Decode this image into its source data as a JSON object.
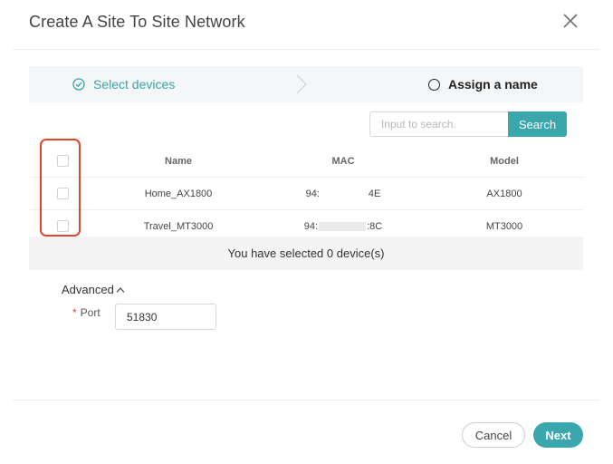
{
  "dialog": {
    "title": "Create A Site To Site Network"
  },
  "steps": {
    "step1_label": "Select devices",
    "step2_label": "Assign a name"
  },
  "search": {
    "placeholder": "Input to search.",
    "button_label": "Search"
  },
  "table": {
    "columns": [
      "Name",
      "MAC",
      "Model"
    ],
    "rows": [
      {
        "name": "Home_AX1800",
        "mac_prefix": "94:",
        "mac_suffix": "4E",
        "model": "AX1800",
        "checked": false
      },
      {
        "name": "Travel_MT3000",
        "mac_prefix": "94:",
        "mac_suffix": ":8C",
        "model": "MT3000",
        "checked": false
      }
    ]
  },
  "summary": {
    "text": "You have selected 0 device(s)"
  },
  "advanced": {
    "label": "Advanced",
    "port_label": "Port",
    "port_required": "*",
    "port_value": "51830"
  },
  "footer": {
    "cancel_label": "Cancel",
    "next_label": "Next"
  },
  "colors": {
    "accent": "#3aa7ad",
    "highlight": "#e0452e"
  }
}
